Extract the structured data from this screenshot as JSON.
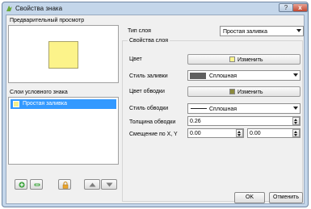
{
  "window": {
    "title": "Свойства знака",
    "help_label": "?",
    "close_label": "x"
  },
  "left": {
    "preview_label": "Предварительный просмотр",
    "preview_color": "#fcf38a",
    "layers_label": "Слои условного знака",
    "layers": [
      {
        "label": "Простая заливка",
        "swatch": "#f4ef8c"
      }
    ],
    "buttons": [
      "add",
      "remove",
      "lock",
      "move-up",
      "move-down"
    ]
  },
  "right": {
    "layer_type_label": "Тип слоя",
    "layer_type_value": "Простая заливка",
    "group_title": "Свойства слоя",
    "color_label": "Цвет",
    "color_button": "Изменить",
    "color_value": "#fdf58e",
    "fill_style_label": "Стиль заливки",
    "fill_style_value": "Сплошная",
    "border_color_label": "Цвет обводки",
    "border_color_button": "Изменить",
    "border_color_value": "#8c8a3c",
    "border_style_label": "Стиль обводки",
    "border_style_value": "Сплошная",
    "border_width_label": "Толщина обводки",
    "border_width_value": "0.26",
    "offset_label": "Смещение по X, Y",
    "offset_x": "0.00",
    "offset_y": "0.00"
  },
  "footer": {
    "ok": "OK",
    "cancel": "Отменить"
  }
}
